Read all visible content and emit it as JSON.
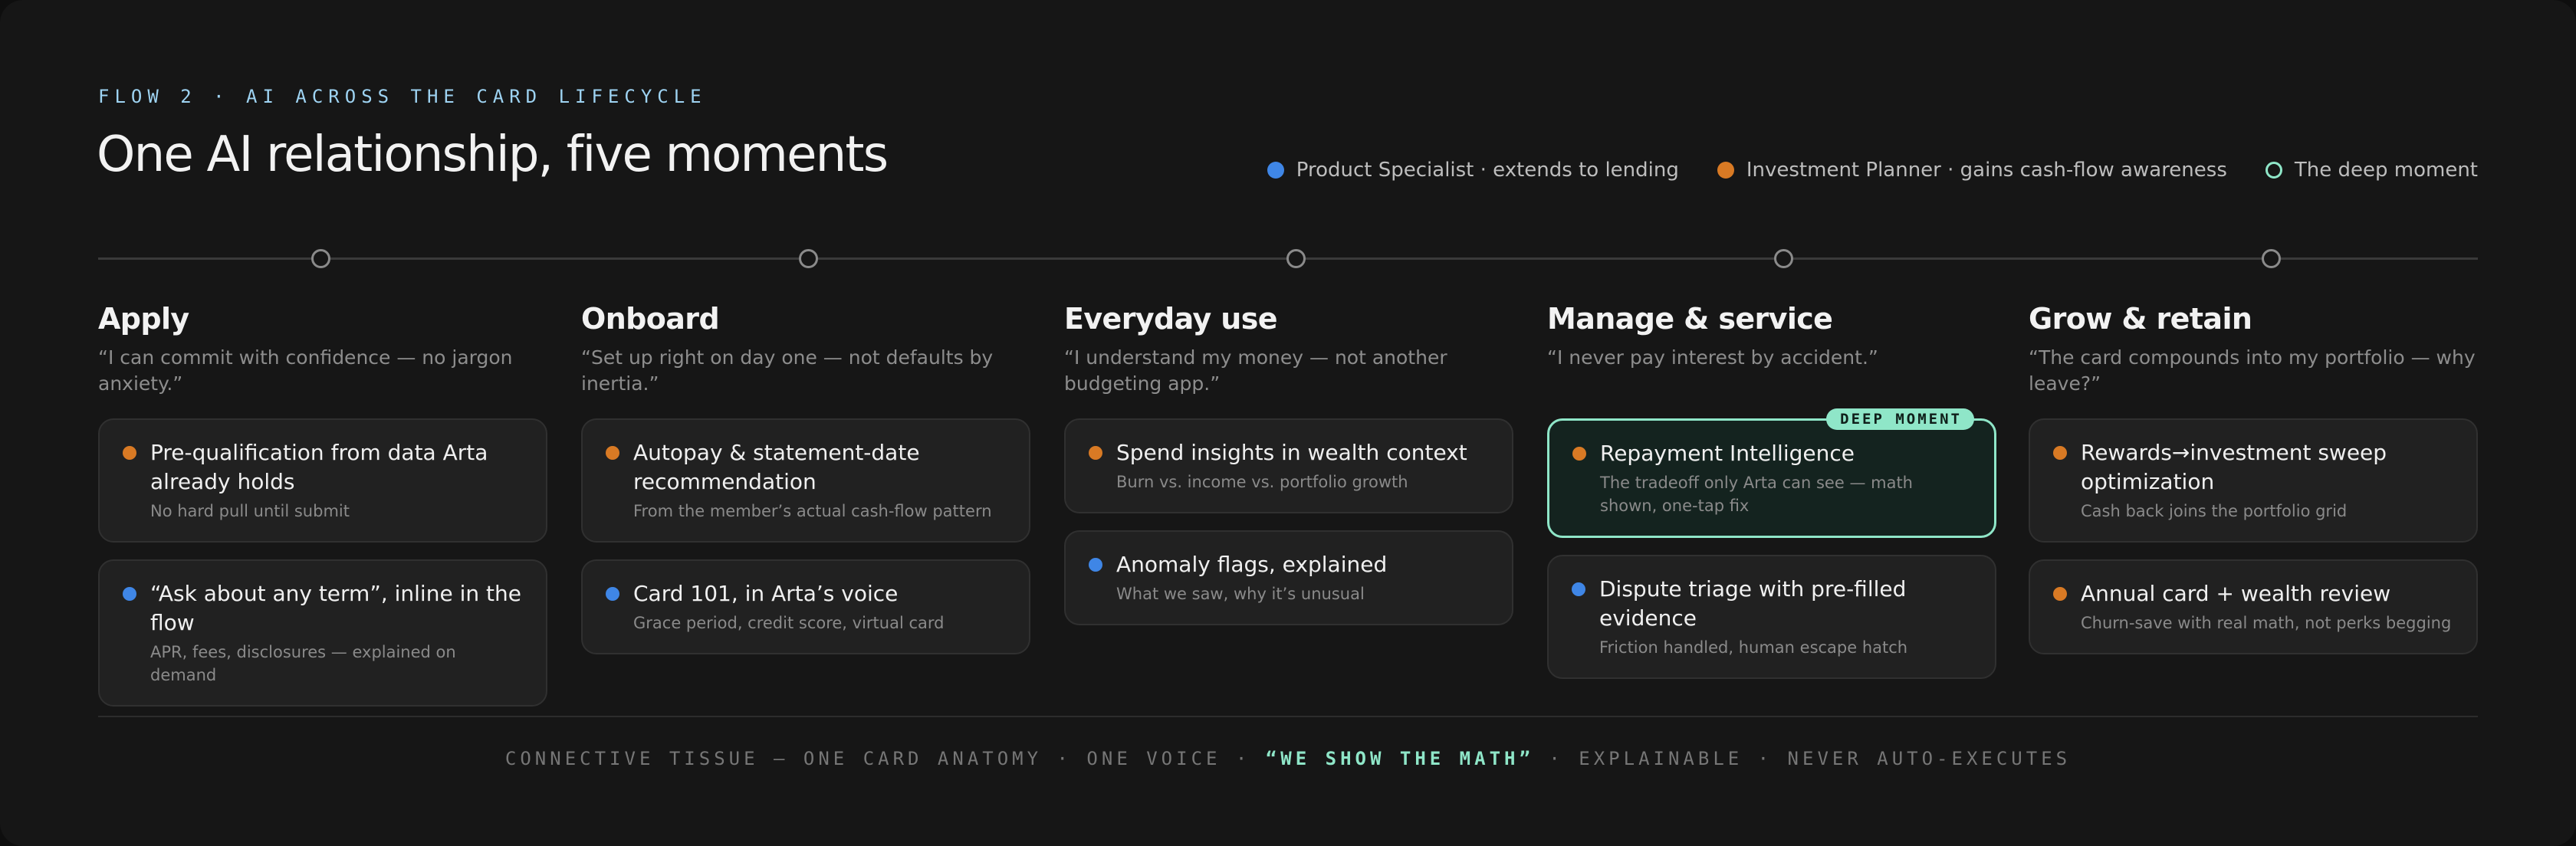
{
  "header": {
    "eyebrow": "FLOW 2 · AI ACROSS THE CARD LIFECYCLE",
    "title": "One AI relationship, five moments"
  },
  "legend": [
    {
      "label": "Product Specialist · extends to lending",
      "color": "#3f86e6",
      "icon": "blue-dot-icon"
    },
    {
      "label": "Investment Planner · gains cash-flow awareness",
      "color": "#d97a24",
      "icon": "orange-dot-icon"
    },
    {
      "label": "The deep moment",
      "color": "#8fe6c8",
      "icon": "ring-icon"
    }
  ],
  "stages": [
    {
      "title": "Apply",
      "quote": "“I can commit with confidence — no jargon anxiety.”",
      "cards": [
        {
          "title": "Pre-qualification from data Arta already holds",
          "sub": "No hard pull until submit",
          "color": "orange"
        },
        {
          "title": "“Ask about any term”, inline in the flow",
          "sub": "APR, fees, disclosures — explained on demand",
          "color": "blue"
        }
      ]
    },
    {
      "title": "Onboard",
      "quote": "“Set up right on day one — not defaults by inertia.”",
      "cards": [
        {
          "title": "Autopay & statement-date recommendation",
          "sub": "From the member’s actual cash-flow pattern",
          "color": "orange"
        },
        {
          "title": "Card 101, in Arta’s voice",
          "sub": "Grace period, credit score, virtual card",
          "color": "blue"
        }
      ]
    },
    {
      "title": "Everyday use",
      "quote": "“I understand my money — not another budgeting app.”",
      "cards": [
        {
          "title": "Spend insights in wealth context",
          "sub": "Burn vs. income vs. portfolio growth",
          "color": "orange"
        },
        {
          "title": "Anomaly flags, explained",
          "sub": "What we saw, why it’s unusual",
          "color": "blue"
        }
      ]
    },
    {
      "title": "Manage & service",
      "quote": "“I never pay interest by accident.”",
      "cards": [
        {
          "title": "Repayment Intelligence",
          "sub": "The tradeoff only Arta can see — math shown, one-tap fix",
          "color": "orange",
          "badge": "DEEP MOMENT"
        },
        {
          "title": "Dispute triage with pre-filled evidence",
          "sub": "Friction handled, human escape hatch",
          "color": "blue"
        }
      ]
    },
    {
      "title": "Grow & retain",
      "quote": "“The card compounds into my portfolio — why leave?”",
      "cards": [
        {
          "title": "Rewards→investment sweep optimization",
          "sub": "Cash back joins the portfolio grid",
          "color": "orange"
        },
        {
          "title": "Annual card + wealth review",
          "sub": "Churn-save with real math, not perks begging",
          "color": "orange"
        }
      ]
    }
  ],
  "footer": {
    "prefix": "CONNECTIVE TISSUE — ONE CARD ANATOMY · ONE VOICE · ",
    "highlight": "“WE SHOW THE MATH”",
    "suffix": " · EXPLAINABLE · NEVER AUTO-EXECUTES"
  }
}
